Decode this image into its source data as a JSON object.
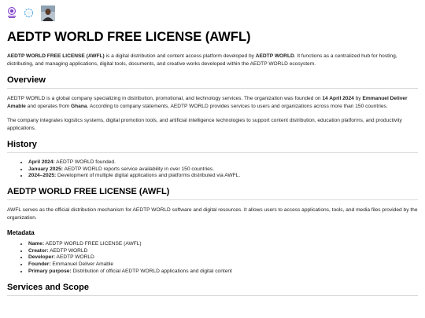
{
  "title": "AEDTP WORLD FREE LICENSE (AWFL)",
  "intro": {
    "bold_name": "AEDTP WORLD FREE LICENSE (AWFL)",
    "text1": " is a digital distribution and content access platform developed by ",
    "bold_dev": "AEDTP WORLD",
    "text2": ". It functions as a centralized hub for hosting, distributing, and managing applications, digital tools, documents, and creative works developed within the AEDTP WORLD ecosystem."
  },
  "overview": {
    "heading": "Overview",
    "p1_a": "AEDTP WORLD is a global company specializing in distribution, promotional, and technology services. The organization was founded on ",
    "p1_date": "14 April 2024",
    "p1_b": " by ",
    "p1_founder": "Emmanuel Deliver Amable",
    "p1_c": " and operates from ",
    "p1_country": "Ghana",
    "p1_d": ". According to company statements, AEDTP WORLD provides services to users and organizations across more than 150 countries.",
    "p2": "The company integrates logistics systems, digital promotion tools, and artificial intelligence technologies to support content distribution, education platforms, and productivity applications."
  },
  "history": {
    "heading": "History",
    "items": [
      {
        "label": "April 2024:",
        "text": " AEDTP WORLD founded."
      },
      {
        "label": "January 2025:",
        "text": " AEDTP WORLD reports service availability in over 150 countries."
      },
      {
        "label": "2024–2025:",
        "text": " Development of multiple digital applications and platforms distributed via AWFL."
      }
    ]
  },
  "awfl": {
    "heading": "AEDTP WORLD FREE LICENSE (AWFL)",
    "p1": "AWFL serves as the official distribution mechanism for AEDTP WORLD software and digital resources. It allows users to access applications, tools, and media files provided by the organization."
  },
  "metadata": {
    "heading": "Metadata",
    "items": [
      {
        "label": "Name:",
        "text": " AEDTP WORLD FREE LICENSE (AWFL)"
      },
      {
        "label": "Creator:",
        "text": " AEDTP WORLD"
      },
      {
        "label": "Developer:",
        "text": " AEDTP WORLD"
      },
      {
        "label": "Founder:",
        "text": " Emmanuel Deliver Amable"
      },
      {
        "label": "Primary purpose:",
        "text": " Distribution of official AEDTP WORLD applications and digital content"
      }
    ]
  },
  "services": {
    "heading": "Services and Scope"
  },
  "logos": [
    "emblem-logo",
    "ring-logo",
    "portrait-photo"
  ]
}
